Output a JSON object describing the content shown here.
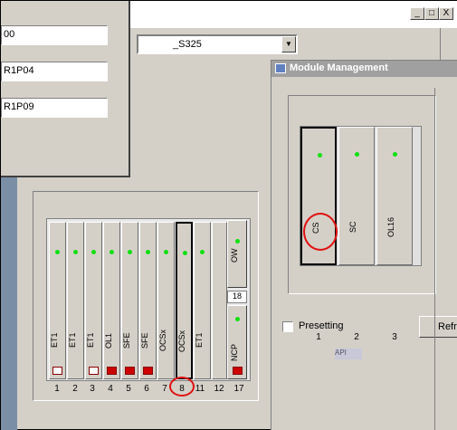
{
  "window": {
    "minimize": "_",
    "maximize": "□",
    "close": "X"
  },
  "combo": {
    "value": "_S325"
  },
  "left_fields": [
    "00",
    "R1P04",
    "R1P09"
  ],
  "rack": {
    "slots": [
      {
        "num": "1",
        "label": "ET1",
        "icon": "hatched"
      },
      {
        "num": "2",
        "label": "ET1",
        "icon": "none"
      },
      {
        "num": "3",
        "label": "ET1",
        "icon": "hatched"
      },
      {
        "num": "4",
        "label": "OL1",
        "icon": "both"
      },
      {
        "num": "5",
        "label": "SFE",
        "icon": "red"
      },
      {
        "num": "6",
        "label": "SFE",
        "icon": "red"
      },
      {
        "num": "7",
        "label": "OCSx",
        "icon": "none"
      },
      {
        "num": "8",
        "label": "OCSx",
        "icon": "none"
      },
      {
        "num": "11",
        "label": "ET1",
        "icon": "none"
      },
      {
        "num": "12",
        "label": "",
        "icon": "none"
      }
    ],
    "right_top": "OW",
    "right_badge": "18",
    "right_bottom": "NCP",
    "right_num": "17"
  },
  "module": {
    "title": "Module Management",
    "cards": [
      {
        "num": "1",
        "label": "CS"
      },
      {
        "num": "2",
        "label": "SC"
      },
      {
        "num": "3",
        "label": "OL16"
      }
    ],
    "presetting": "Presetting",
    "refresh": "Refr",
    "apis": "API"
  },
  "colors": {
    "led": "#10e010",
    "annotation": "#e01010",
    "panel": "#d4d0c8"
  }
}
